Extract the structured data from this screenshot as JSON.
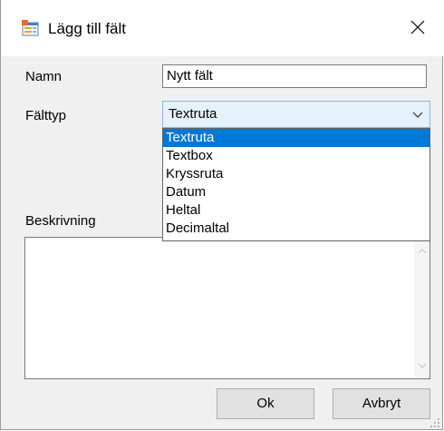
{
  "window": {
    "title": "Lägg till fält"
  },
  "form": {
    "name_label": "Namn",
    "name_value": "Nytt fält",
    "type_label": "Fälttyp",
    "type_selected": "Textruta",
    "description_label": "Beskrivning",
    "description_value": ""
  },
  "dropdown": {
    "options": [
      "Textruta",
      "Textbox",
      "Kryssruta",
      "Datum",
      "Heltal",
      "Decimaltal"
    ],
    "highlighted_index": 0
  },
  "buttons": {
    "ok_label": "Ok",
    "cancel_label": "Avbryt"
  },
  "icons": {
    "app": "form-window-icon",
    "close": "close-icon",
    "combo_arrow": "chevron-down-icon",
    "scroll_up": "scroll-up-arrow-icon",
    "scroll_down": "scroll-down-arrow-icon",
    "grip": "resize-grip-icon"
  },
  "colors": {
    "selection": "#0078d7",
    "combo_bg": "#e5f1fb",
    "combo_border": "#8fb8dd",
    "dialog_bg": "#f0f0f0"
  }
}
